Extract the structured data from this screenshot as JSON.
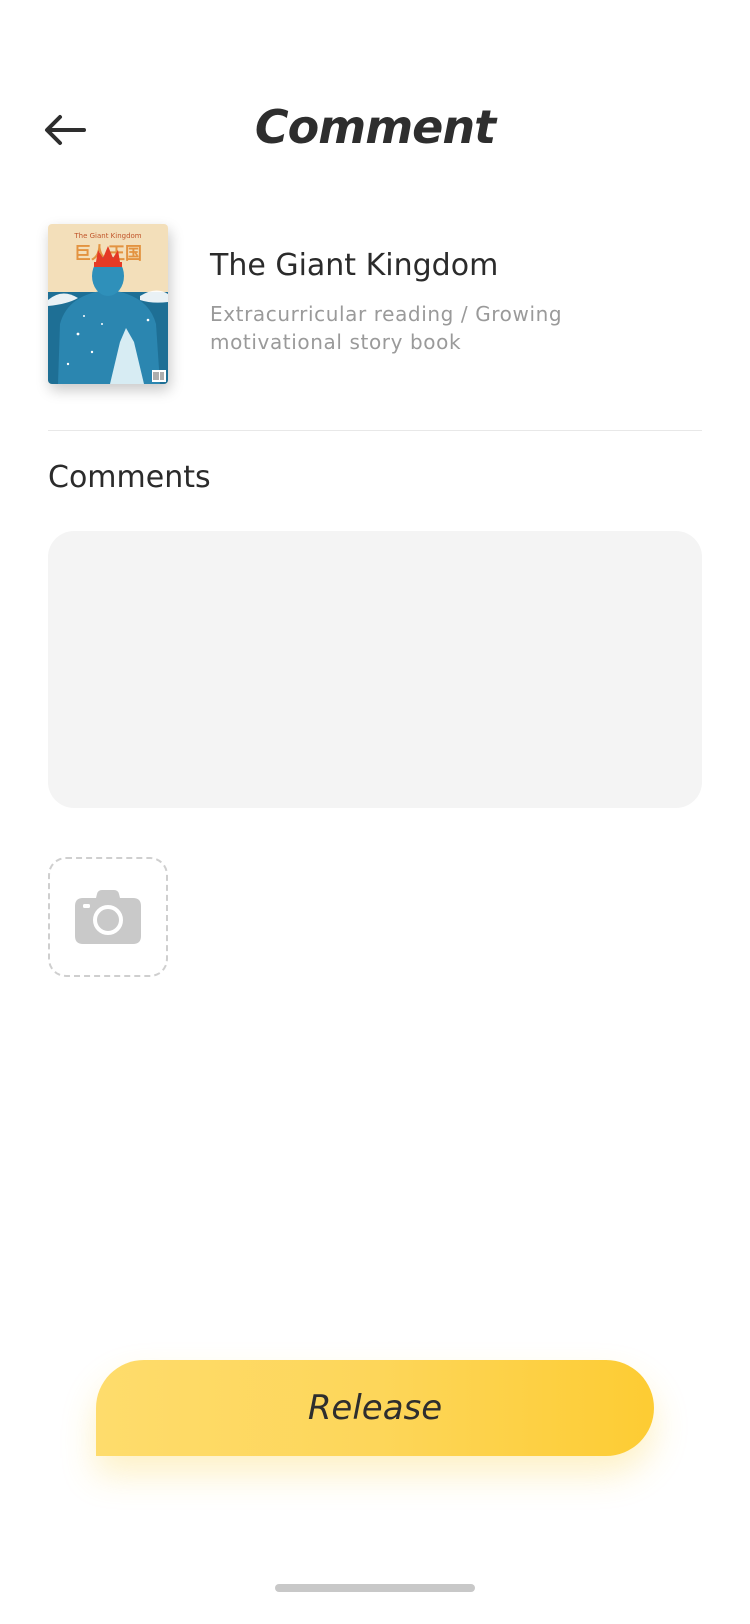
{
  "header": {
    "title": "Comment"
  },
  "book": {
    "title": "The Giant Kingdom",
    "description": "Extracurricular reading / Growing motivational story book",
    "cover": {
      "top_text": "The Giant Kingdom",
      "cn_title": "巨人王国"
    }
  },
  "comments": {
    "label": "Comments",
    "value": "",
    "placeholder": ""
  },
  "photo_upload": {
    "icon": "camera-icon"
  },
  "release": {
    "label": "Release"
  },
  "colors": {
    "accent_start": "#fedc6c",
    "accent_end": "#fdcc33",
    "input_bg": "#f4f4f4",
    "secondary_text": "#9a9a9a"
  }
}
